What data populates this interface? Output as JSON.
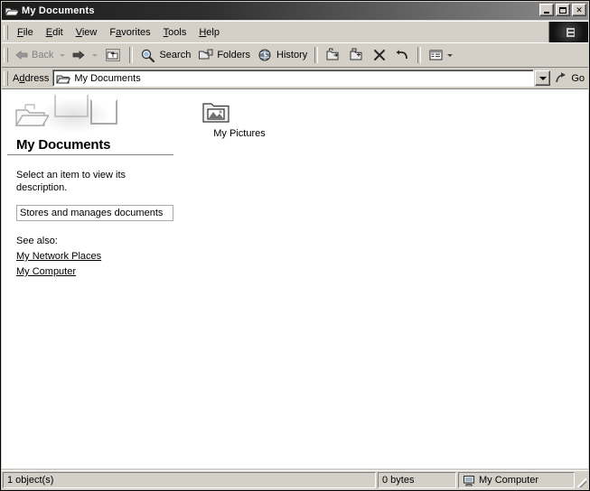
{
  "window": {
    "title": "My Documents",
    "title_icon": "folder-open-icon",
    "controls": {
      "minimize": "minimize-button",
      "maximize": "maximize-button",
      "close_label": "✕"
    }
  },
  "menubar": {
    "items": [
      {
        "label": "File",
        "accel": "F",
        "before": "",
        "after": "ile"
      },
      {
        "label": "Edit",
        "accel": "E",
        "before": "",
        "after": "dit"
      },
      {
        "label": "View",
        "accel": "V",
        "before": "",
        "after": "iew"
      },
      {
        "label": "Favorites",
        "accel": "a",
        "before": "F",
        "after": "vorites"
      },
      {
        "label": "Tools",
        "accel": "T",
        "before": "",
        "after": "ools"
      },
      {
        "label": "Help",
        "accel": "H",
        "before": "",
        "after": "elp"
      }
    ],
    "brand_icon": "windows-logo-icon"
  },
  "toolbar": {
    "back_label": "Back",
    "back_icon": "arrow-left-icon",
    "forward_icon": "arrow-right-icon",
    "up_icon": "up-one-level-icon",
    "search_label": "Search",
    "search_icon": "search-icon",
    "folders_label": "Folders",
    "folders_icon": "folders-icon",
    "history_label": "History",
    "history_icon": "history-icon",
    "move_to_icon": "move-to-folder-icon",
    "copy_to_icon": "copy-to-folder-icon",
    "delete_icon": "delete-x-icon",
    "undo_icon": "undo-arrow-icon",
    "views_icon": "views-icon"
  },
  "addressbar": {
    "label_before": "A",
    "label_accel": "d",
    "label_after": "dress",
    "value": "My Documents",
    "icon": "folder-open-icon",
    "go_label": "Go",
    "go_icon": "go-arrow-icon"
  },
  "leftpanel": {
    "heading": "My Documents",
    "description_line1": "Select an item to view its",
    "description_line2": "description.",
    "tooltip_text": "Stores and manages documents",
    "see_also_label": "See also:",
    "links": [
      {
        "label": "My Network Places"
      },
      {
        "label": "My Computer"
      }
    ]
  },
  "files": [
    {
      "name": "My Pictures",
      "icon": "folder-pictures-icon"
    }
  ],
  "statusbar": {
    "objects": "1 object(s)",
    "size": "0 bytes",
    "location": "My Computer",
    "location_icon": "computer-icon"
  },
  "colors": {
    "face": "#d4d0c8",
    "titlebar_dark": "#1c1c1c",
    "text": "#000000",
    "content_bg": "#ffffff"
  }
}
